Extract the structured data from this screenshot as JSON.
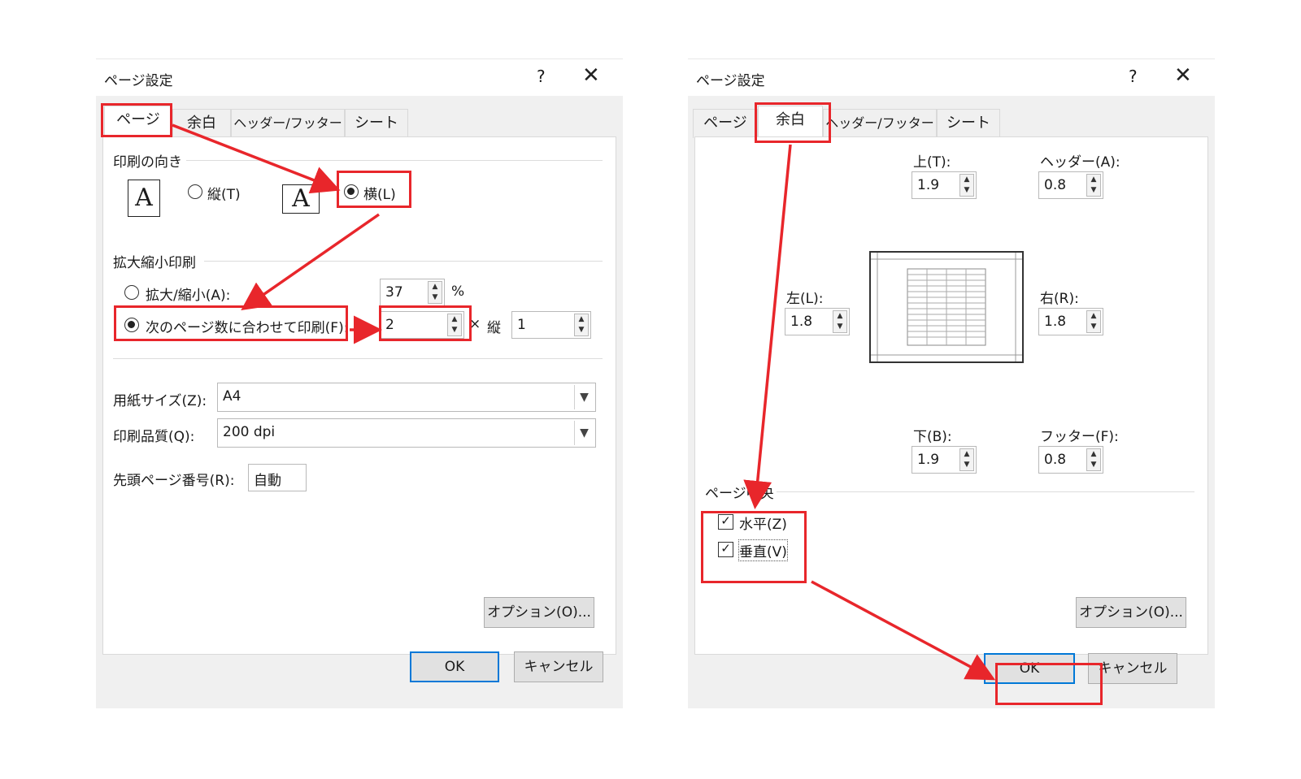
{
  "left_dialog": {
    "title": "ページ設定",
    "help": "?",
    "close": "✕",
    "tabs": [
      "ページ",
      "余白",
      "ヘッダー/フッター",
      "シート"
    ],
    "orientation": {
      "section": "印刷の向き",
      "icon_letter": "A",
      "portrait": "縦(T)",
      "landscape": "横(L)"
    },
    "scaling": {
      "section": "拡大縮小印刷",
      "adjust_label": "拡大/縮小(A):",
      "adjust_value": "37",
      "percent": "%",
      "fit_label": "次のページ数に合わせて印刷(F):",
      "wide_value": "2",
      "times": "×",
      "tall_label": "縦",
      "tall_value": "1"
    },
    "paper_size_label": "用紙サイズ(Z):",
    "paper_size_value": "A4",
    "quality_label": "印刷品質(Q):",
    "quality_value": "200 dpi",
    "first_page_label": "先頭ページ番号(R):",
    "first_page_value": "自動",
    "options": "オプション(O)...",
    "ok": "OK",
    "cancel": "キャンセル"
  },
  "right_dialog": {
    "title": "ページ設定",
    "help": "?",
    "close": "✕",
    "tabs": [
      "ページ",
      "余白",
      "ヘッダー/フッター",
      "シート"
    ],
    "top_label": "上(T):",
    "top_value": "1.9",
    "header_label": "ヘッダー(A):",
    "header_value": "0.8",
    "left_label": "左(L):",
    "left_value": "1.8",
    "right_label": "右(R):",
    "right_value": "1.8",
    "bottom_label": "下(B):",
    "bottom_value": "1.9",
    "footer_label": "フッター(F):",
    "footer_value": "0.8",
    "center_section": "ページ中央",
    "horizontal": "水平(Z)",
    "vertical": "垂直(V)",
    "check_mark": "✓",
    "options": "オプション(O)...",
    "ok": "OK",
    "cancel": "キャンセル"
  },
  "colors": {
    "highlight": "#e8262b",
    "ok_border": "#0078d7"
  }
}
